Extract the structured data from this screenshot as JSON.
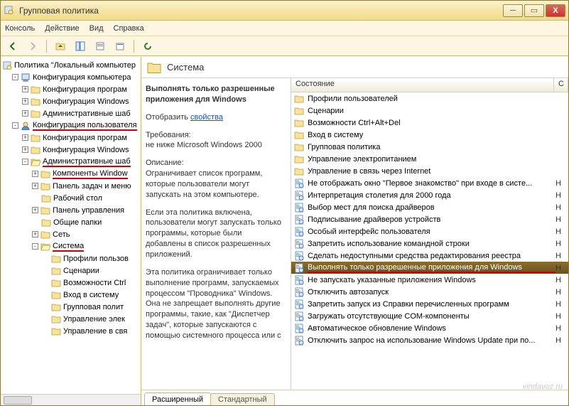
{
  "window": {
    "title": "Групповая политика"
  },
  "menu": {
    "console": "Консоль",
    "action": "Действие",
    "view": "Вид",
    "help": "Справка"
  },
  "tree": {
    "root": "Политика \"Локальный компьютер",
    "items": [
      {
        "d": 1,
        "e": "-",
        "label": "Конфигурация компьютера",
        "kind": "comp"
      },
      {
        "d": 2,
        "e": "+",
        "label": "Конфигурация програм",
        "kind": "f"
      },
      {
        "d": 2,
        "e": "+",
        "label": "Конфигурация Windows",
        "kind": "f"
      },
      {
        "d": 2,
        "e": "+",
        "label": "Административные шаб",
        "kind": "f"
      },
      {
        "d": 1,
        "e": "-",
        "label": "Конфигурация пользователя",
        "kind": "user",
        "ul": true
      },
      {
        "d": 2,
        "e": "+",
        "label": "Конфигурация програм",
        "kind": "f"
      },
      {
        "d": 2,
        "e": "+",
        "label": "Конфигурация Windows",
        "kind": "f"
      },
      {
        "d": 2,
        "e": "-",
        "label": "Административные шаб",
        "kind": "fo",
        "ul": true
      },
      {
        "d": 3,
        "e": "+",
        "label": "Компоненты Window",
        "kind": "f",
        "ul": true
      },
      {
        "d": 3,
        "e": "+",
        "label": "Панель задач и меню",
        "kind": "f"
      },
      {
        "d": 3,
        "e": " ",
        "label": "Рабочий стол",
        "kind": "f"
      },
      {
        "d": 3,
        "e": "+",
        "label": "Панель управления",
        "kind": "f"
      },
      {
        "d": 3,
        "e": " ",
        "label": "Общие папки",
        "kind": "f"
      },
      {
        "d": 3,
        "e": "+",
        "label": "Сеть",
        "kind": "f"
      },
      {
        "d": 3,
        "e": "-",
        "label": "Система",
        "kind": "fo",
        "ul": true
      },
      {
        "d": 4,
        "e": " ",
        "label": "Профили пользов",
        "kind": "f"
      },
      {
        "d": 4,
        "e": " ",
        "label": "Сценарии",
        "kind": "f"
      },
      {
        "d": 4,
        "e": " ",
        "label": "Возможности Ctrl",
        "kind": "f"
      },
      {
        "d": 4,
        "e": " ",
        "label": "Вход в систему",
        "kind": "f"
      },
      {
        "d": 4,
        "e": " ",
        "label": "Групповая полит",
        "kind": "f"
      },
      {
        "d": 4,
        "e": " ",
        "label": "Управление элек",
        "kind": "f"
      },
      {
        "d": 4,
        "e": " ",
        "label": "Управление в свя",
        "kind": "f"
      }
    ]
  },
  "header": {
    "title": "Система"
  },
  "description": {
    "title": "Выполнять только разрешенные приложения для Windows",
    "display_label": "Отобразить",
    "properties_link": "свойства",
    "req_label": "Требования:",
    "req_text": "не ниже Microsoft Windows 2000",
    "desc_label": "Описание:",
    "p1": "Ограничивает список программ, которые пользователи могут запускать на этом компьютере.",
    "p2": "Если эта политика включена, пользователи могут запускать только программы, которые были добавлены в список разрешенных приложений.",
    "p3": "Эта политика ограничивает только выполнение программ, запускаемых процессом \"Проводника\" Windows. Она не запрещает выполнять другие программы, такие, как \"Диспетчер задач\", которые запускаются с помощью системного процесса или с"
  },
  "list": {
    "col_state": "Состояние",
    "col_s": "С",
    "state_val": "Н",
    "items": [
      {
        "t": "Профили пользователей",
        "k": "f"
      },
      {
        "t": "Сценарии",
        "k": "f"
      },
      {
        "t": "Возможности Ctrl+Alt+Del",
        "k": "f"
      },
      {
        "t": "Вход в систему",
        "k": "f"
      },
      {
        "t": "Групповая политика",
        "k": "f"
      },
      {
        "t": "Управление электропитанием",
        "k": "f"
      },
      {
        "t": "Управление в связь через Internet",
        "k": "f"
      },
      {
        "t": "Не отображать окно \"Первое знакомство\" при входе в систе...",
        "k": "p"
      },
      {
        "t": "Интерпретация столетия для 2000 года",
        "k": "p"
      },
      {
        "t": "Выбор мест для поиска драйверов",
        "k": "p"
      },
      {
        "t": "Подписывание драйверов устройств",
        "k": "p"
      },
      {
        "t": "Особый интерфейс пользователя",
        "k": "p"
      },
      {
        "t": "Запретить использование командной строки",
        "k": "p"
      },
      {
        "t": "Сделать недоступными средства редактирования реестра",
        "k": "p"
      },
      {
        "t": "Выполнять только разрешенные приложения для Windows",
        "k": "p",
        "sel": true
      },
      {
        "t": "Не запускать указанные приложения Windows",
        "k": "p"
      },
      {
        "t": "Отключить автозапуск",
        "k": "p"
      },
      {
        "t": "Запретить запуск из Справки перечисленных программ",
        "k": "p"
      },
      {
        "t": "Загружать отсутствующие COM-компоненты",
        "k": "p"
      },
      {
        "t": "Автоматическое обновление Windows",
        "k": "p"
      },
      {
        "t": "Отключить запрос на использование Windows Update при по...",
        "k": "p"
      }
    ]
  },
  "tabs": {
    "extended": "Расширенный",
    "standard": "Стандартный"
  },
  "watermark": "vindavoz.ru"
}
